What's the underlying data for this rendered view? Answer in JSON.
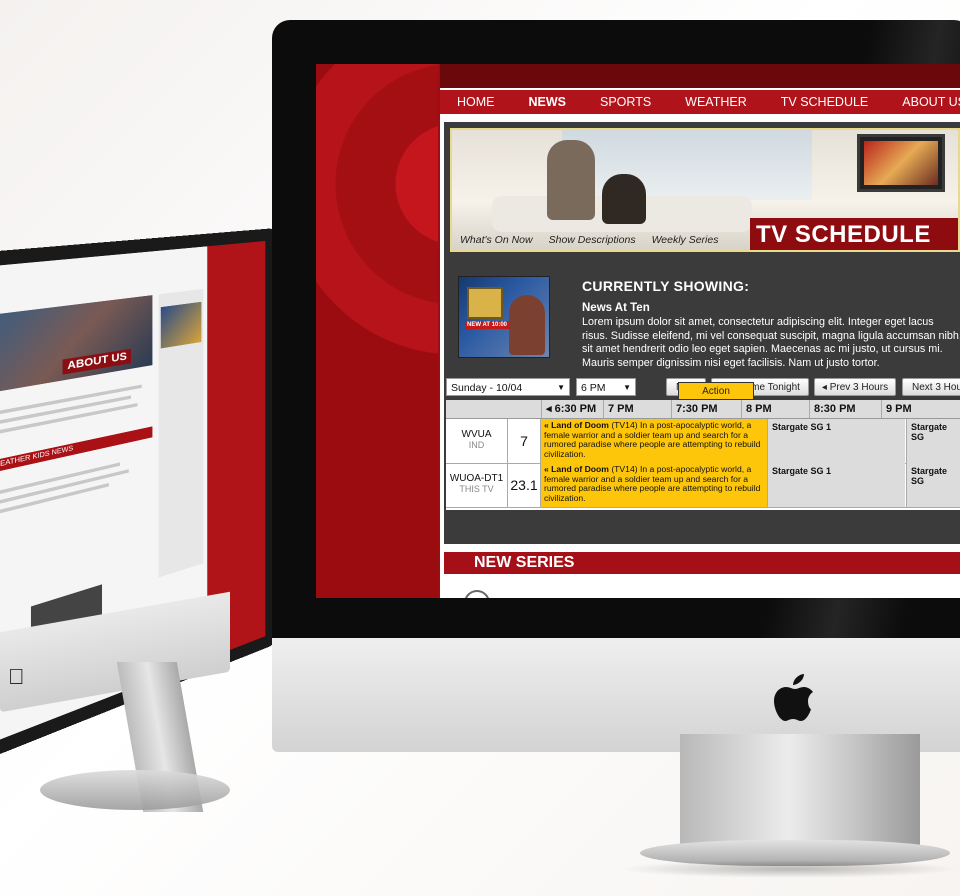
{
  "nav": [
    "HOME",
    "NEWS",
    "SPORTS",
    "WEATHER",
    "TV SCHEDULE",
    "ABOUT US"
  ],
  "nav_active": "NEWS",
  "hero": {
    "links": [
      "What's On Now",
      "Show Descriptions",
      "Weekly Series"
    ],
    "title": "TV SCHEDULE"
  },
  "current": {
    "heading": "CURRENTLY SHOWING:",
    "show": "News At Ten",
    "description": "Lorem ipsum dolor sit amet, consectetur adipiscing elit. Integer eget lacus risus. Sudisse eleifend, mi vel consequat suscipit, magna ligula accumsan nibh, sit amet hendrerit odio leo eget sapien. Maecenas ac mi justo, ut cursus mi. Mauris semper dignissim nisi eget facilisis. Nam ut justo tortor.",
    "thumb_label": "NEW AT 10:00"
  },
  "controls": {
    "day": "Sunday - 10/04",
    "time": "6 PM",
    "now": "Now",
    "primetime": "Primetime Tonight",
    "prev": "◂ Prev 3 Hours",
    "next": "Next 3 Hou"
  },
  "grid": {
    "times": [
      "◂  6:30 PM",
      "7 PM",
      "7:30 PM",
      "8 PM",
      "8:30 PM",
      "9 PM"
    ],
    "rows": [
      {
        "channel": "WVUA",
        "sub": "IND",
        "number": "7",
        "highlight_title": "« Land of Doom",
        "highlight_desc": " (TV14) In a post-apocalyptic world, a female warrior and a soldier team up and search for a rumored paradise where people are attempting to rebuild civilization.",
        "show_8pm": "Stargate SG 1",
        "show_9pm": "Stargate SG"
      },
      {
        "channel": "WUOA-DT1",
        "sub": "THIS TV",
        "number": "23.1",
        "highlight_title": "« Land of Doom",
        "highlight_desc": " (TV14) In a post-apocalyptic world, a female warrior and a soldier team up and search for a rumored paradise where people are attempting to rebuild civilization.",
        "show_8pm": "Stargate SG 1",
        "show_9pm": "Stargate SG"
      }
    ],
    "action_label": "Action"
  },
  "new_series": "NEW SERIES",
  "left_site": {
    "about": "ABOUT US",
    "news_strip": "WEATHER KIDS NEWS"
  },
  "colors": {
    "brand_red": "#b1131a",
    "dark_red": "#6a080b",
    "highlight_yellow": "#fdc60a",
    "panel_gray": "#3b3b3b"
  }
}
